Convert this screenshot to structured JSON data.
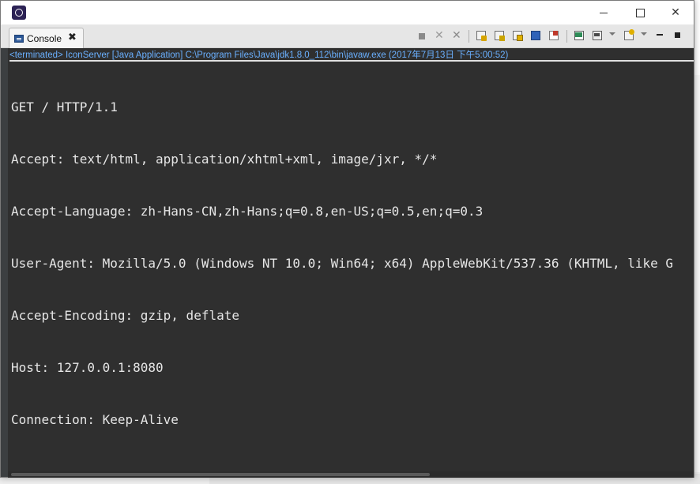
{
  "window": {
    "title": ""
  },
  "view_tab": {
    "label": "Console",
    "close_glyph": "✖"
  },
  "toolbar": {
    "icons": [
      "terminate-icon",
      "remove-launch-icon",
      "remove-all-terminated-icon",
      "scroll-lock-icon",
      "word-wrap-icon",
      "show-stdout-icon",
      "show-stderr-icon",
      "pin-console-icon",
      "display-selected-console-icon",
      "open-console-icon",
      "minimize-icon",
      "maximize-icon"
    ]
  },
  "console": {
    "status": "<terminated> IconServer [Java Application] C:\\Program Files\\Java\\jdk1.8.0_112\\bin\\javaw.exe (2017年7月13日 下午5:00:52)",
    "lines": [
      "GET / HTTP/1.1",
      "Accept: text/html, application/xhtml+xml, image/jxr, */*",
      "Accept-Language: zh-Hans-CN,zh-Hans;q=0.8,en-US;q=0.5,en;q=0.3",
      "User-Agent: Mozilla/5.0 (Windows NT 10.0; Win64; x64) AppleWebKit/537.36 (KHTML, like G",
      "Accept-Encoding: gzip, deflate",
      "Host: 127.0.0.1:8080",
      "Connection: Keep-Alive"
    ]
  },
  "colors": {
    "console_bg": "#2f2f2f",
    "console_text": "#e6e6e6",
    "status_text": "#6ab0ff"
  }
}
